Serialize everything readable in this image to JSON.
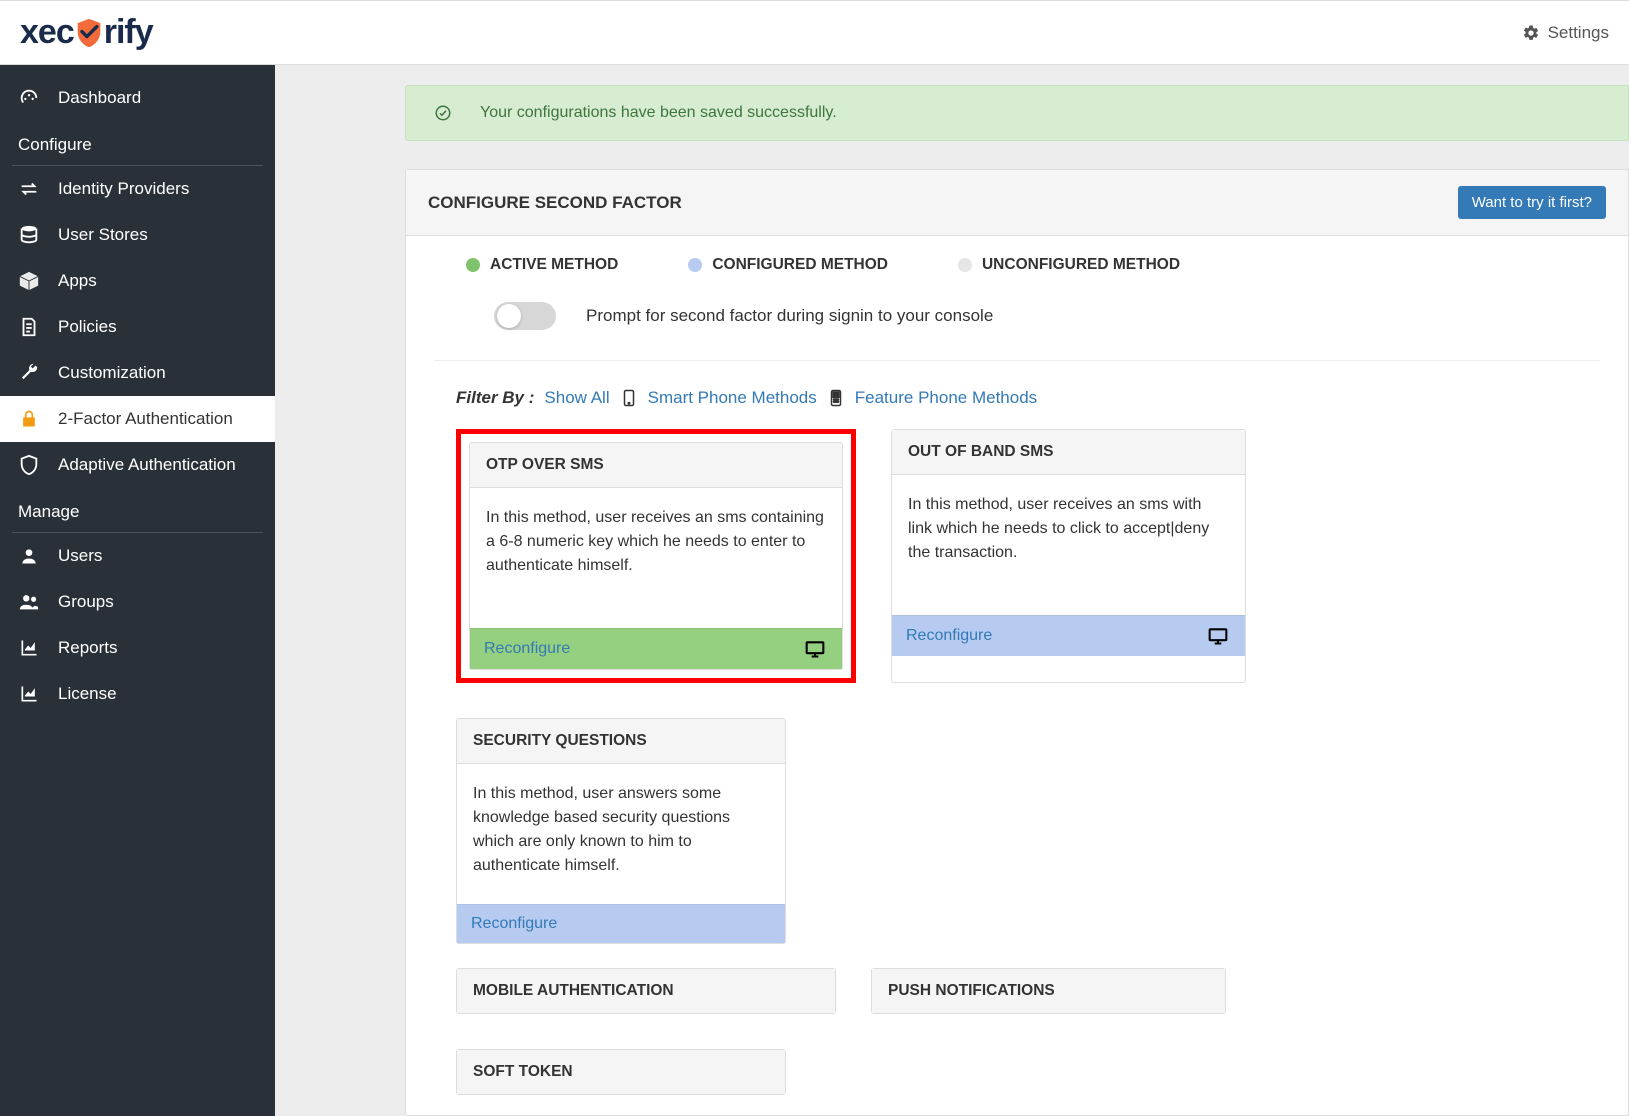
{
  "brand": {
    "part1": "xec",
    "part2": "rify"
  },
  "header": {
    "settings": "Settings"
  },
  "sidebar": {
    "items": [
      {
        "label": "Dashboard"
      },
      {
        "label": "Identity Providers"
      },
      {
        "label": "User Stores"
      },
      {
        "label": "Apps"
      },
      {
        "label": "Policies"
      },
      {
        "label": "Customization"
      },
      {
        "label": "2-Factor Authentication"
      },
      {
        "label": "Adaptive Authentication"
      },
      {
        "label": "Users"
      },
      {
        "label": "Groups"
      },
      {
        "label": "Reports"
      },
      {
        "label": "License"
      }
    ],
    "headings": {
      "configure": "Configure",
      "manage": "Manage"
    }
  },
  "alert": {
    "message": "Your configurations have been saved successfully."
  },
  "panel": {
    "title": "CONFIGURE SECOND FACTOR",
    "try_button": "Want to try it first?",
    "legend": {
      "active": "ACTIVE METHOD",
      "configured": "CONFIGURED METHOD",
      "unconfigured": "UNCONFIGURED METHOD"
    },
    "toggle_label": "Prompt for second factor during signin to your console",
    "filter": {
      "label": "Filter By :",
      "show_all": "Show All",
      "smart": "Smart Phone Methods",
      "feature": "Feature Phone Methods"
    },
    "cards": [
      {
        "title": "OTP OVER SMS",
        "body": "In this method, user receives an sms containing a 6-8 numeric key which he needs to enter to authenticate himself.",
        "action": "Reconfigure"
      },
      {
        "title": "OUT OF BAND SMS",
        "body": "In this method, user receives an sms with link which he needs to click to accept|deny the transaction.",
        "action": "Reconfigure"
      },
      {
        "title": "SECURITY QUESTIONS",
        "body": "In this method, user answers some knowledge based security questions which are only known to him to authenticate himself.",
        "action": "Reconfigure"
      }
    ],
    "cards_row2": [
      {
        "title": "MOBILE AUTHENTICATION"
      },
      {
        "title": "PUSH NOTIFICATIONS"
      },
      {
        "title": "SOFT TOKEN"
      }
    ]
  }
}
